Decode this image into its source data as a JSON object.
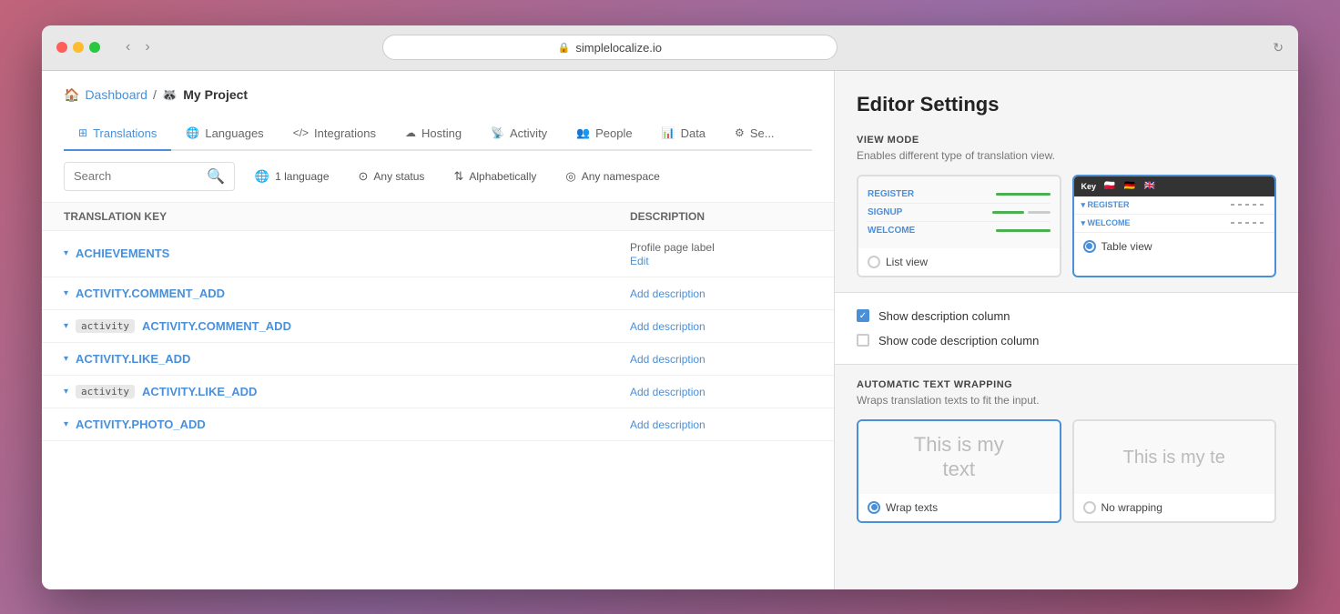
{
  "browser": {
    "url": "simplelocalize.io",
    "back_label": "‹",
    "forward_label": "›",
    "reload_label": "↻"
  },
  "app": {
    "breadcrumb": {
      "dashboard_label": "Dashboard",
      "separator": "/",
      "project_icon": "🦝",
      "project_name": "My Project"
    },
    "nav_tabs": [
      {
        "label": "Translations",
        "icon": "⊞",
        "active": true
      },
      {
        "label": "Languages",
        "icon": "🌐",
        "active": false
      },
      {
        "label": "Integrations",
        "icon": "</>",
        "active": false
      },
      {
        "label": "Hosting",
        "icon": "☁",
        "active": false
      },
      {
        "label": "Activity",
        "icon": "((·))",
        "active": false
      },
      {
        "label": "People",
        "icon": "👥",
        "active": false
      },
      {
        "label": "Data",
        "icon": "📊",
        "active": false
      },
      {
        "label": "Se...",
        "icon": "⚙",
        "active": false
      }
    ],
    "filters": {
      "search_placeholder": "Search",
      "language_filter": "1 language",
      "status_filter": "Any status",
      "sort_filter": "Alphabetically",
      "namespace_filter": "Any namespace"
    },
    "table": {
      "headers": [
        "Translation Key",
        "Description"
      ],
      "rows": [
        {
          "key": "ACHIEVEMENTS",
          "badge": null,
          "description_text": "Profile page label",
          "description_edit": "Edit",
          "has_description": true
        },
        {
          "key": "ACTIVITY.COMMENT_ADD",
          "badge": null,
          "description_text": null,
          "description_add": "Add description",
          "has_description": false
        },
        {
          "key": "ACTIVITY.COMMENT_ADD",
          "badge": "activity",
          "description_text": null,
          "description_add": "Add description",
          "has_description": false
        },
        {
          "key": "ACTIVITY.LIKE_ADD",
          "badge": null,
          "description_text": null,
          "description_add": "Add description",
          "has_description": false
        },
        {
          "key": "ACTIVITY.LIKE_ADD",
          "badge": "activity",
          "description_text": null,
          "description_add": "Add description",
          "has_description": false
        },
        {
          "key": "ACTIVITY.PHOTO_ADD",
          "badge": null,
          "description_text": null,
          "description_add": "Add description",
          "has_description": false
        }
      ]
    }
  },
  "settings_panel": {
    "title": "Editor Settings",
    "view_mode": {
      "label": "VIEW MODE",
      "description": "Enables different type of translation view.",
      "list_view": {
        "label": "List view",
        "selected": false,
        "rows": [
          {
            "key": "REGISTER",
            "bar_color": "green"
          },
          {
            "key": "SIGNUP",
            "bar_color": "green",
            "bar2_color": "gray"
          },
          {
            "key": "WELCOME",
            "bar_color": "green"
          }
        ]
      },
      "table_view": {
        "label": "Table view",
        "selected": true,
        "header_key_label": "Key",
        "rows": [
          {
            "key": "REGISTER"
          },
          {
            "key": "WELCOME"
          }
        ]
      }
    },
    "checkboxes": {
      "show_description": {
        "label": "Show description column",
        "checked": true
      },
      "show_code_description": {
        "label": "Show code description column",
        "checked": false
      }
    },
    "text_wrapping": {
      "label": "AUTOMATIC TEXT WRAPPING",
      "description": "Wraps translation texts to fit the input.",
      "wrap_texts": {
        "label": "Wrap texts",
        "selected": true,
        "preview_text": "This is my text",
        "preview_line1": "This is my",
        "preview_line2": "text"
      },
      "no_wrapping": {
        "label": "No wrapping",
        "selected": false,
        "preview_text": "This is my te"
      }
    }
  }
}
